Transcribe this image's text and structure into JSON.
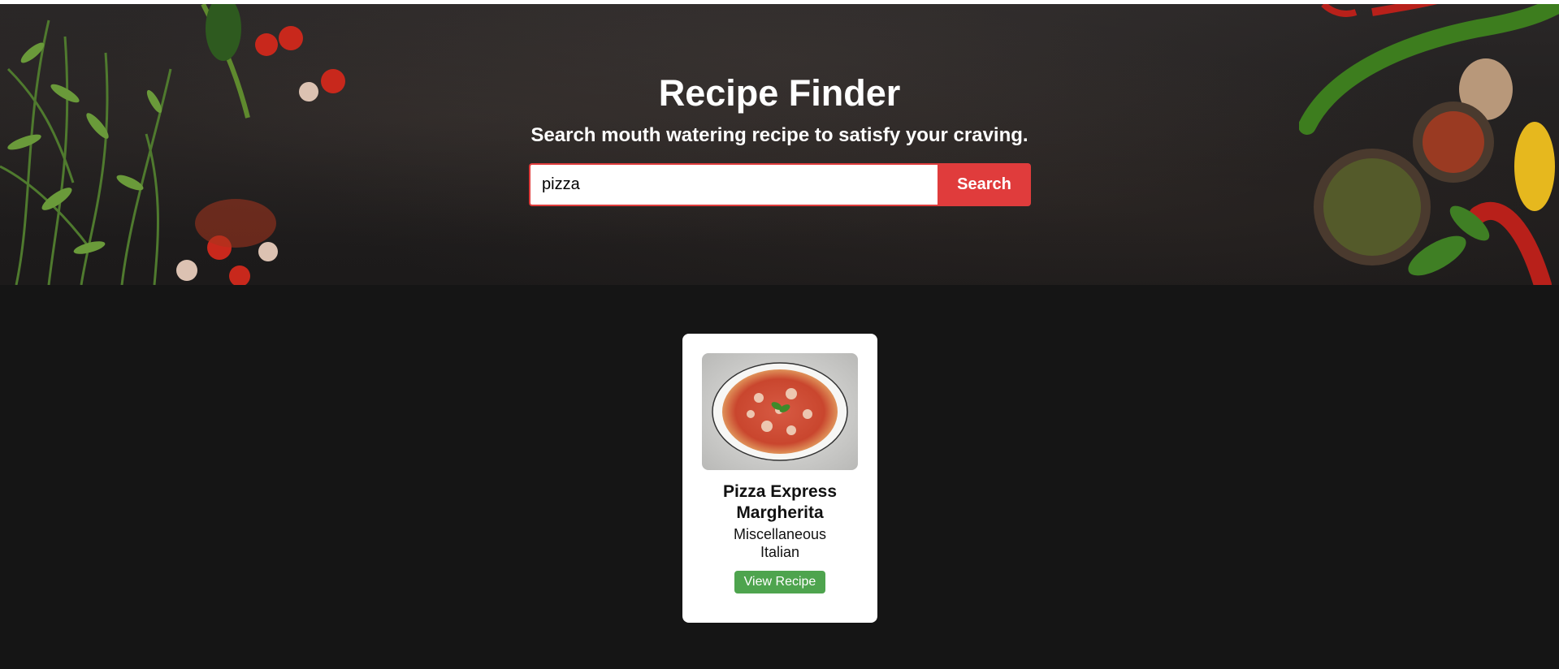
{
  "hero": {
    "title": "Recipe Finder",
    "subtitle": "Search mouth watering recipe to satisfy your craving.",
    "search": {
      "value": "pizza",
      "button_label": "Search"
    }
  },
  "results": [
    {
      "title": "Pizza Express Margherita",
      "category": "Miscellaneous",
      "area": "Italian",
      "button_label": "View Recipe"
    }
  ],
  "colors": {
    "accent_red": "#e03c3c",
    "button_green": "#4ea44e",
    "page_background": "#151515"
  }
}
